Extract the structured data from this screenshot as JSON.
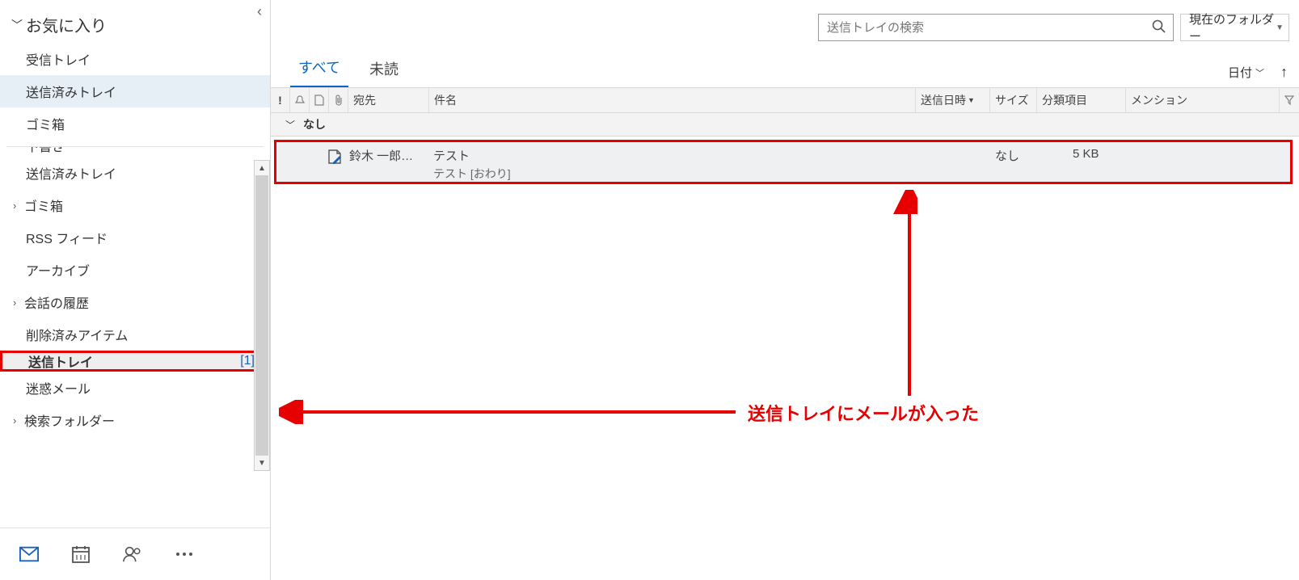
{
  "sidebar": {
    "collapse_glyph": "‹",
    "favorites_title": "お気に入り",
    "favorites": [
      {
        "label": "受信トレイ"
      },
      {
        "label": "送信済みトレイ",
        "selected": true
      },
      {
        "label": "ゴミ箱"
      }
    ],
    "account_folders": [
      {
        "label": "下書き",
        "indent": 1,
        "clipped": true
      },
      {
        "label": "送信済みトレイ",
        "indent": 1
      },
      {
        "label": "ゴミ箱",
        "indent": 0,
        "expandable": true
      },
      {
        "label": "RSS フィード",
        "indent": 1
      },
      {
        "label": "アーカイブ",
        "indent": 1
      },
      {
        "label": "会話の履歴",
        "indent": 0,
        "expandable": true
      },
      {
        "label": "削除済みアイテム",
        "indent": 1
      },
      {
        "label": "送信トレイ",
        "indent": 1,
        "bold": true,
        "count": "[1]",
        "highlight": true
      },
      {
        "label": "迷惑メール",
        "indent": 1
      },
      {
        "label": "検索フォルダー",
        "indent": 0,
        "expandable": true
      }
    ]
  },
  "search": {
    "placeholder": "送信トレイの検索",
    "scope_label": "現在のフォルダー"
  },
  "tabs": {
    "all": "すべて",
    "unread": "未読",
    "sort_label": "日付"
  },
  "columns": {
    "to": "宛先",
    "subject": "件名",
    "sent": "送信日時",
    "size": "サイズ",
    "categories": "分類項目",
    "mention": "メンション"
  },
  "group": {
    "label": "なし"
  },
  "messages": [
    {
      "to": "鈴木 一郎…",
      "subject": "テスト",
      "preview": "テスト [おわり]",
      "sent": "なし",
      "size": "5 KB"
    }
  ],
  "annotation": {
    "text": "送信トレイにメールが入った"
  }
}
